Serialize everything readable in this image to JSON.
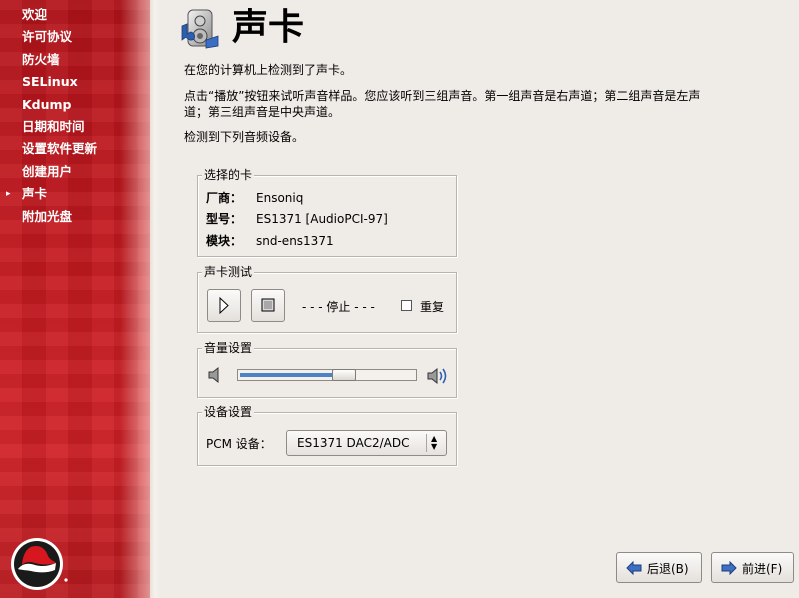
{
  "sidebar": {
    "items": [
      {
        "label": "欢迎",
        "current": false
      },
      {
        "label": "许可协议",
        "current": false
      },
      {
        "label": "防火墙",
        "current": false
      },
      {
        "label": "SELinux",
        "current": false
      },
      {
        "label": "Kdump",
        "current": false
      },
      {
        "label": "日期和时间",
        "current": false
      },
      {
        "label": "设置软件更新",
        "current": false
      },
      {
        "label": "创建用户",
        "current": false
      },
      {
        "label": "声卡",
        "current": true
      },
      {
        "label": "附加光盘",
        "current": false
      }
    ],
    "current_marker": "▸"
  },
  "header": {
    "title": "声卡",
    "icon": "soundcard-speaker-icon"
  },
  "text": {
    "detected": "在您的计算机上检测到了声卡。",
    "instructions": "点击“播放”按钮来试听声音样品。您应该听到三组声音。第一组声音是右声道；第二组声音是左声道；第三组声音是中央声道。",
    "devices": "检测到下列音频设备。"
  },
  "selected_card": {
    "legend": "选择的卡",
    "vendor_label": "厂商：",
    "vendor": "Ensoniq",
    "model_label": "型号：",
    "model": "ES1371 [AudioPCI-97]",
    "module_label": "模块：",
    "module": "snd-ens1371"
  },
  "sound_test": {
    "legend": "声卡测试",
    "play_icon": "play-icon",
    "stop_icon": "stop-icon",
    "status": "- - -  停止 - - -",
    "repeat_label": "重复",
    "repeat_checked": false
  },
  "volume": {
    "legend": "音量设置",
    "level": 0.62,
    "low_icon": "speaker-low-icon",
    "high_icon": "speaker-high-icon"
  },
  "device": {
    "legend": "设备设置",
    "pcm_label": "PCM 设备：",
    "pcm_value": "ES1371 DAC2/ADC"
  },
  "nav": {
    "back": "后退(B)",
    "next": "前进(F)"
  },
  "colors": {
    "sidebar_red": "#c51a20",
    "slider_fill": "#4d83c6",
    "background": "#efebe7"
  }
}
